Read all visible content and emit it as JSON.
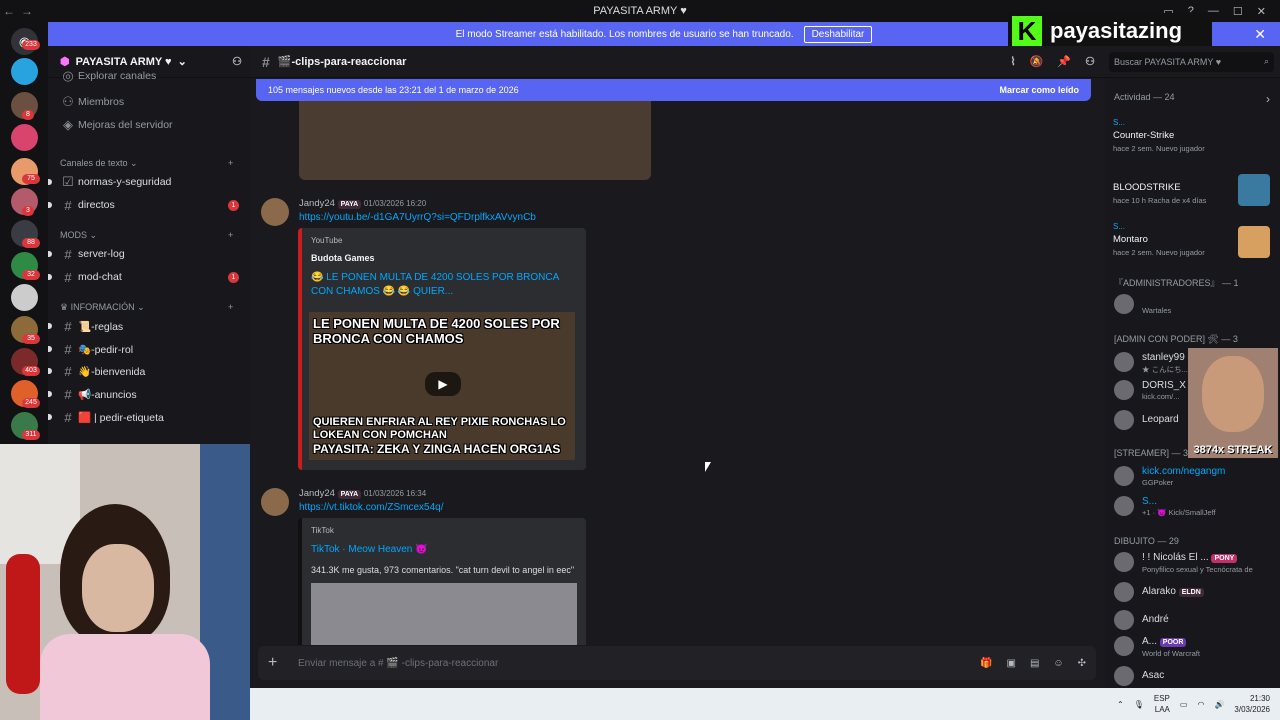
{
  "window": {
    "title": "PAYASITA ARMY ♥",
    "back": "←",
    "forward": "→"
  },
  "streamer_bar": {
    "text": "El modo Streamer está habilitado. Los nombres de usuario se han truncado.",
    "button": "Deshabilitar"
  },
  "overlay_logo": {
    "text": "payasitazing",
    "brand_color": "#53fc18"
  },
  "guild_badges": [
    "233",
    "8",
    "75",
    "3",
    "88",
    "32",
    "35",
    "403",
    "245",
    "311"
  ],
  "server": {
    "name": "PAYASITA ARMY ♥",
    "partial_items": [
      "Explorar canales",
      "Miembros",
      "Mejoras del servidor"
    ]
  },
  "categories": {
    "text": "Canales de texto",
    "mods": "MODS",
    "info": "INFORMACIÓN"
  },
  "channels": [
    {
      "name": "normas-y-seguridad",
      "badge": ""
    },
    {
      "name": "directos",
      "badge": "1"
    },
    {
      "name": "server-log",
      "badge": ""
    },
    {
      "name": "mod-chat",
      "badge": "1"
    },
    {
      "name": "📜-reglas",
      "badge": ""
    },
    {
      "name": "🎭-pedir-rol",
      "badge": ""
    },
    {
      "name": "👋-bienvenida",
      "badge": ""
    },
    {
      "name": "📢-anuncios",
      "badge": ""
    },
    {
      "name": "🟥 | pedir-etiqueta",
      "badge": ""
    }
  ],
  "chat": {
    "channel": "🎬-clips-para-reaccionar",
    "new_messages": "105 mensajes nuevos desde las 23:21 del 1 de marzo de 2026",
    "mark_read": "Marcar como leído",
    "composer_placeholder": "Enviar mensaje a # 🎬 -clips-para-reaccionar"
  },
  "search": {
    "placeholder": "Buscar PAYASITA ARMY ♥"
  },
  "messages": [
    {
      "user": "Jandy24",
      "tag": "PAYA",
      "time": "01/03/2026 16:20",
      "link": "https://youtu.be/-d1GA7UyrrQ?si=QFDrplfkxAVvynCb",
      "provider": "YouTube",
      "author": "Budota Games",
      "title": "😂 LE PONEN MULTA DE 4200 SOLES POR BRONCA CON CHAMOS 😂 😂 QUIER...",
      "thumb_top": "LE PONEN MULTA DE 4200 SOLES POR BRONCA CON CHAMOS",
      "thumb_bottom1": "QUIEREN ENFRIAR AL REY PIXIE RONCHAS LO LOKEAN CON POMCHAN",
      "thumb_bottom2": "PAYASITA: ZEKA Y ZINGA HACEN ORG1AS"
    },
    {
      "user": "Jandy24",
      "tag": "PAYA",
      "time": "01/03/2026 16:34",
      "link": "https://vt.tiktok.com/ZSmcex54q/",
      "provider": "TikTok",
      "title": "TikTok · Meow Heaven 😈",
      "desc": "341.3K me gusta, 973 comentarios. \"cat turn devil to angel in eec\""
    }
  ],
  "activity": {
    "header": "Actividad — 24",
    "items": [
      {
        "user": "S...",
        "name": "Counter-Strike",
        "sub": "hace 2 sem.  Nuevo jugador"
      },
      {
        "user": "",
        "name": "BLOODSTRIKE",
        "sub": "hace 10 h  Racha de x4 días"
      },
      {
        "user": "S...",
        "name": "Montaro",
        "sub": "hace 2 sem.  Nuevo jugador"
      }
    ]
  },
  "member_groups": [
    {
      "title": "『ADMINISTRADORES』 — 1",
      "members": [
        {
          "name": "",
          "sub": "Wartales"
        }
      ]
    },
    {
      "title": "[ADMIN CON PODER] 🛠 — 3",
      "members": [
        {
          "name": "stanley99",
          "sub": "★ こんにち..."
        },
        {
          "name": "DORIS_X",
          "sub": "kick.com/..."
        },
        {
          "name": "Leopard",
          "sub": ""
        }
      ]
    },
    {
      "title": "[STREAMER] — 3",
      "members": [
        {
          "name": "kick.com/negangm",
          "sub": "GGPoker"
        },
        {
          "name": "S...",
          "sub": "+1 · 😈 Kick/SmallJeff"
        }
      ]
    },
    {
      "title": "DIBUJITO — 29",
      "members": [
        {
          "name": "! ! Nicolás El ...",
          "tag": "PONY",
          "sub": "Ponyfilico sexual y Tecnócrata de"
        },
        {
          "name": "Alarako",
          "tag": "ELDN",
          "sub": ""
        },
        {
          "name": "André",
          "sub": ""
        },
        {
          "name": "A...",
          "tag": "POOR",
          "sub": "World of Warcraft"
        },
        {
          "name": "Asac",
          "sub": ""
        }
      ]
    }
  ],
  "meme_caption": "3874x STREAK",
  "taskbar": {
    "lang1": "ESP",
    "lang2": "LAA",
    "time": "21:30",
    "date": "3/03/2026"
  }
}
